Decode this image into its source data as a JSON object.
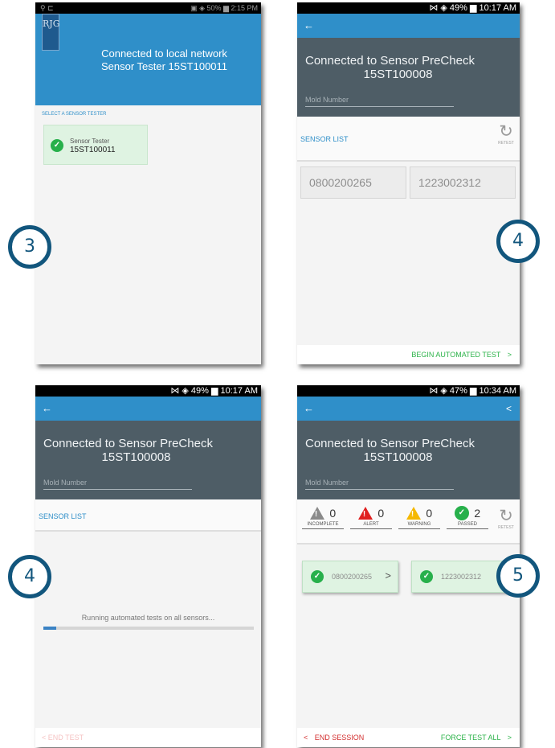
{
  "screens": {
    "s1": {
      "status_left": "⚲ ⊏",
      "status_right": "▣ ◈ 50% ▆ 2:15 PM",
      "logo_text": "RJG",
      "title": "Connected to local network",
      "subtitle": "Sensor Tester 15ST100011",
      "select_label": "SELECT A SENSOR TESTER",
      "tester_label": "Sensor Tester",
      "tester_id": "15ST100011",
      "step": "3"
    },
    "s2": {
      "status_right": "⋈ ◈ 49% ▆ 10:17 AM",
      "back": "←",
      "connected": "Connected to Sensor PreCheck",
      "device_id": "15ST100008",
      "mold_placeholder": "Mold Number",
      "list_label": "SENSOR LIST",
      "retest_label": "RETEST",
      "sensors": [
        "0800200265",
        "1223002312"
      ],
      "action": "BEGIN AUTOMATED TEST",
      "action_chevron": ">",
      "step": "4"
    },
    "s3": {
      "status_right": "⋈ ◈ 49% ▆ 10:17 AM",
      "back": "←",
      "connected": "Connected to Sensor PreCheck",
      "device_id": "15ST100008",
      "mold_placeholder": "Mold Number",
      "list_label": "SENSOR LIST",
      "progress_text": "Running automated tests on all sensors...",
      "progress": 0.06,
      "end_test": "< END TEST",
      "step": "4"
    },
    "s4": {
      "status_right": "⋈ ◈ 47% ▆ 10:34 AM",
      "back": "←",
      "share": "<",
      "connected": "Connected to Sensor PreCheck",
      "device_id": "15ST100008",
      "mold_placeholder": "Mold Number",
      "stats": [
        {
          "label": "INCOMPLETE",
          "count": "0",
          "color": "#8a8a8a"
        },
        {
          "label": "ALERT",
          "count": "0",
          "color": "#e02020"
        },
        {
          "label": "WARNING",
          "count": "0",
          "color": "#f5b800"
        },
        {
          "label": "PASSED",
          "count": "2",
          "color": "#27b04b"
        }
      ],
      "retest_label": "RETEST",
      "sensors": [
        "0800200265",
        "1223002312"
      ],
      "sensor_chevron": ">",
      "end_session": "END SESSION",
      "end_chevron": "<",
      "force_test": "FORCE TEST ALL",
      "force_chevron": ">",
      "step": "5"
    }
  },
  "colors": {
    "app_blue": "#2f8fc9",
    "header_slate": "#4e5d66",
    "passed_green": "#27b04b",
    "alert_red": "#d32f2f",
    "badge_blue": "#12567d"
  }
}
